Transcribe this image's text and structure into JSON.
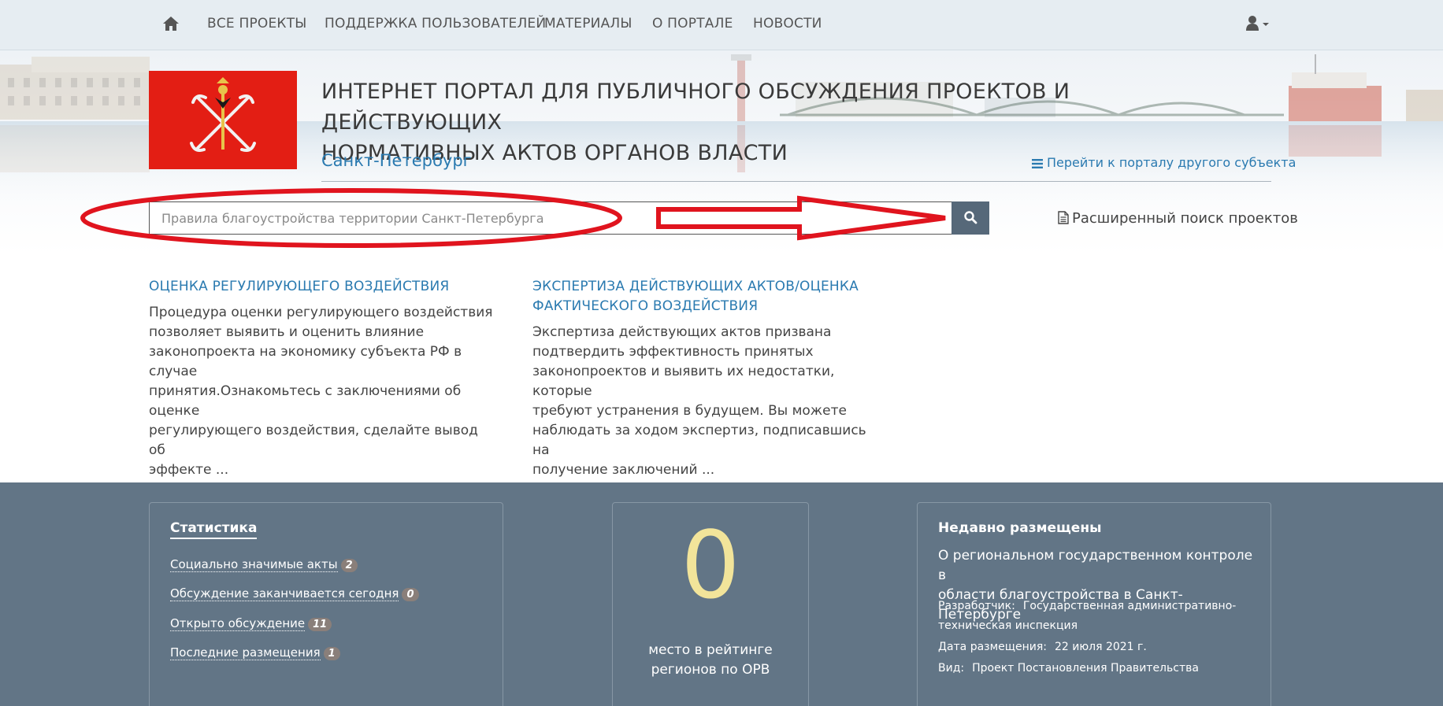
{
  "nav": {
    "items": [
      {
        "label": "ВСЕ ПРОЕКТЫ"
      },
      {
        "label": "ПОДДЕРЖКА ПОЛЬЗОВАТЕЛЕЙ"
      },
      {
        "label": "МАТЕРИАЛЫ"
      },
      {
        "label": "О ПОРТАЛЕ"
      },
      {
        "label": "НОВОСТИ"
      }
    ],
    "home_icon": "home-icon",
    "user_icon": "user-icon"
  },
  "header": {
    "title_line1": "ИНТЕРНЕТ ПОРТАЛ ДЛЯ ПУБЛИЧНОГО ОБСУЖДЕНИЯ ПРОЕКТОВ И ДЕЙСТВУЮЩИХ",
    "title_line2": "НОРМАТИВНЫХ АКТОВ ОРГАНОВ ВЛАСТИ",
    "region": "Санкт-Петербург",
    "switch_link": "Перейти к порталу другого субъекта",
    "logo_color": "#e31e14"
  },
  "search": {
    "placeholder": "Правила благоустройства территории Санкт-Петербурга",
    "button_icon": "search-icon",
    "advanced_link": "Расширенный поиск проектов"
  },
  "sections": [
    {
      "title_line1": "ОЦЕНКА РЕГУЛИРУЮЩЕГО ВОЗДЕЙСТВИЯ",
      "title_line2": "",
      "text": [
        "Процедура оценки регулирующего воздействия",
        "позволяет выявить и оценить влияние",
        "законопроекта на экономику субъекта РФ в случае",
        "принятия.Ознакомьтесь с заключениями об оценке",
        "регулирующего воздействия, сделайте вывод об",
        "эффекте ..."
      ]
    },
    {
      "title_line1": "ЭКСПЕРТИЗА ДЕЙСТВУЮЩИХ АКТОВ/ОЦЕНКА",
      "title_line2": "ФАКТИЧЕСКОГО ВОЗДЕЙСТВИЯ",
      "text": [
        "Экспертиза действующих актов призвана",
        "подтвердить эффективность принятых",
        "законопроектов и выявить их недостатки, которые",
        "требуют устранения в будущем. Вы можете",
        "наблюдать за ходом экспертиз, подписавшись на",
        "получение заключений ..."
      ]
    }
  ],
  "stats": {
    "title": "Статистика",
    "items": [
      {
        "label": "Социально значимые акты",
        "count": "2"
      },
      {
        "label": "Обсуждение заканчивается сегодня",
        "count": "0"
      },
      {
        "label": "Открыто обсуждение",
        "count": "11"
      },
      {
        "label": "Последние размещения",
        "count": "1"
      }
    ]
  },
  "rank": {
    "value": "0",
    "line1": "место в рейтинге",
    "line2": "регионов по ОРВ"
  },
  "recent": {
    "title": "Недавно размещены",
    "name_line1": "О региональном государственном контроле в",
    "name_line2": "области благоустройства в Санкт-Петербурге",
    "developer_label": "Разработчик:",
    "developer_line1": "Государственная административно-",
    "developer_line2": "техническая инспекция",
    "date_label": "Дата размещения:",
    "date": "22 июля 2021 г.",
    "type_label": "Вид:",
    "type": "Проект Постановления Правительства"
  },
  "colors": {
    "nav_bg": "#e6edf2",
    "link": "#2a7ab0",
    "footer_bg": "#627586",
    "rank_number": "#f2e49a",
    "annotation_red": "#e0141e"
  }
}
